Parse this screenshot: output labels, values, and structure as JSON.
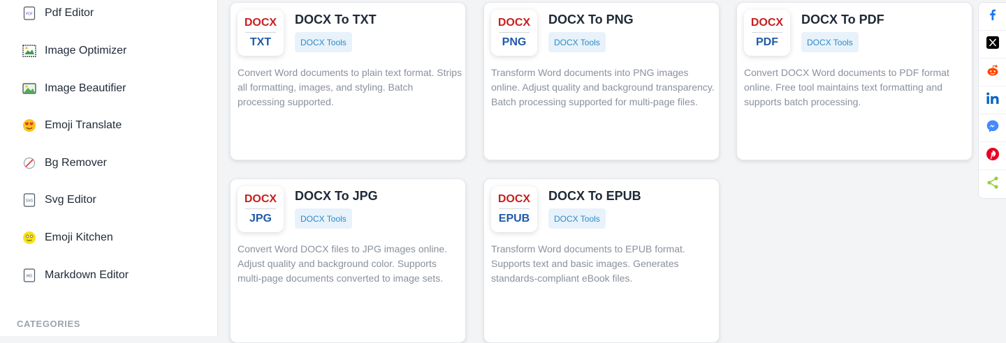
{
  "sidebar": {
    "items": [
      {
        "label": "Pdf Editor",
        "icon": "pdf-file-icon"
      },
      {
        "label": "Image Optimizer",
        "icon": "image-optimizer-icon"
      },
      {
        "label": "Image Beautifier",
        "icon": "landscape-image-icon"
      },
      {
        "label": "Emoji Translate",
        "icon": "heart-eyes-emoji-icon"
      },
      {
        "label": "Bg Remover",
        "icon": "slash-circle-icon"
      },
      {
        "label": "Svg Editor",
        "icon": "svg-file-icon"
      },
      {
        "label": "Emoji Kitchen",
        "icon": "emoji-face-icon"
      },
      {
        "label": "Markdown Editor",
        "icon": "md-file-icon"
      }
    ],
    "categories_heading": "CATEGORIES"
  },
  "tools": [
    {
      "badge_top": "DOCX",
      "badge_bottom": "TXT",
      "title": "DOCX To TXT",
      "tag": "DOCX Tools",
      "description": "Convert Word documents to plain text format. Strips all formatting, images, and styling. Batch processing supported."
    },
    {
      "badge_top": "DOCX",
      "badge_bottom": "PNG",
      "title": "DOCX To PNG",
      "tag": "DOCX Tools",
      "description": "Transform Word documents into PNG images online. Adjust quality and background transparency. Batch processing supported for multi-page files."
    },
    {
      "badge_top": "DOCX",
      "badge_bottom": "PDF",
      "title": "DOCX To PDF",
      "tag": "DOCX Tools",
      "description": "Convert DOCX Word documents to PDF format online. Free tool maintains text formatting and supports batch processing."
    },
    {
      "badge_top": "DOCX",
      "badge_bottom": "JPG",
      "title": "DOCX To JPG",
      "tag": "DOCX Tools",
      "description": "Convert Word DOCX files to JPG images online. Adjust quality and background color. Supports multi-page documents converted to image sets."
    },
    {
      "badge_top": "DOCX",
      "badge_bottom": "EPUB",
      "title": "DOCX To EPUB",
      "tag": "DOCX Tools",
      "description": "Transform Word documents to EPUB format. Supports text and basic images. Generates standards-compliant eBook files."
    }
  ],
  "share": {
    "buttons": [
      {
        "icon": "facebook-icon",
        "color": "#1877f2"
      },
      {
        "icon": "x-icon",
        "color": "#000000"
      },
      {
        "icon": "reddit-icon",
        "color": "#ff4500"
      },
      {
        "icon": "linkedin-icon",
        "color": "#0a66c2"
      },
      {
        "icon": "messenger-icon",
        "color": "#448aff"
      },
      {
        "icon": "pinterest-icon",
        "color": "#e60023"
      },
      {
        "icon": "share-icon",
        "color": "#95d03a"
      }
    ]
  },
  "colors": {
    "badge_top": "#c81e1e",
    "badge_bottom": "#1e5aa8",
    "tag_bg": "#e8f2fb",
    "tag_text": "#2b8ac8"
  }
}
